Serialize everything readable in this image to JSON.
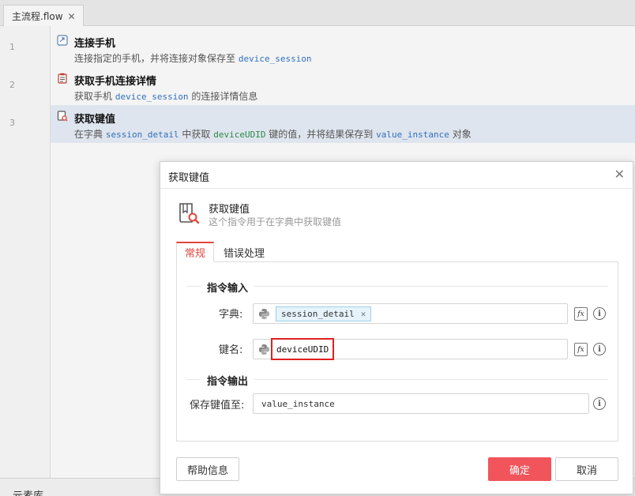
{
  "tab": {
    "label": "主流程.flow",
    "close": "✕"
  },
  "editor": {
    "steps": [
      {
        "line": "1",
        "title": "连接手机",
        "desc_a": "连接指定的手机，并将连接对象保存至",
        "var1": "device_session"
      },
      {
        "line": "2",
        "title": "获取手机连接详情",
        "desc_a": "获取手机",
        "var1": "device_session",
        "desc_b": "的连接详情信息"
      },
      {
        "line": "3",
        "title": "获取键值",
        "desc_a": "在字典",
        "var1": "session_detail",
        "desc_b": "中获取",
        "var2": "deviceUDID",
        "desc_c": "键的值，并将结果保存到",
        "var3": "value_instance",
        "desc_d": "对象"
      }
    ]
  },
  "bottom": {
    "label": "元素库"
  },
  "dialog": {
    "title": "获取键值",
    "close": "✕",
    "command_name": "获取键值",
    "command_desc": "这个指令用于在字典中获取键值",
    "tabs": [
      {
        "label": "常规"
      },
      {
        "label": "错误处理"
      }
    ],
    "input_section": "指令输入",
    "output_section": "指令输出",
    "dict_label": "字典:",
    "dict_chip": "session_detail",
    "chip_close": "✕",
    "key_label": "键名:",
    "key_value": "deviceUDID",
    "save_label": "保存键值至:",
    "save_value": "value_instance",
    "fx": "fx",
    "info": "i",
    "help_button": "帮助信息",
    "ok_button": "确定",
    "cancel_button": "取消"
  },
  "colors": {
    "accent": "#f2545b",
    "highlight_box": "#e02020",
    "var_blue": "#2f6fbf",
    "var_green": "#2a8a4a"
  }
}
